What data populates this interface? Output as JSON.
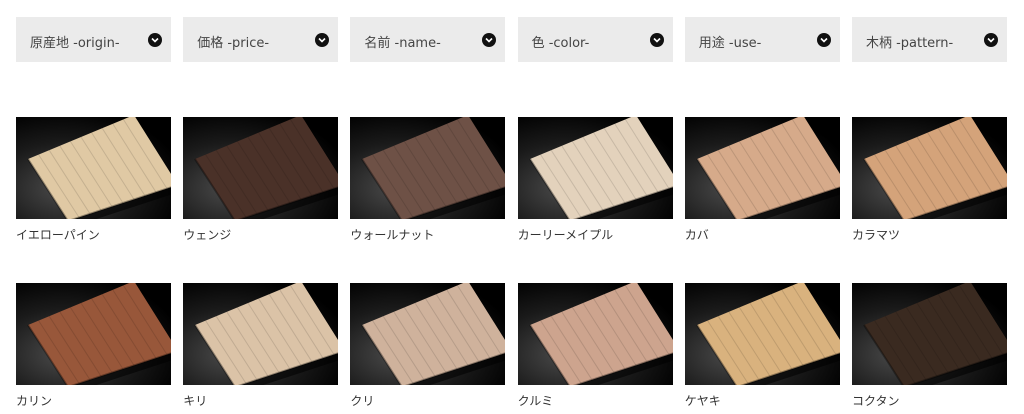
{
  "filters": [
    {
      "label": "原産地 -origin-",
      "icon": "chevron-down-icon"
    },
    {
      "label": "価格 -price-",
      "icon": "chevron-down-icon"
    },
    {
      "label": "名前 -name-",
      "icon": "chevron-down-icon"
    },
    {
      "label": "色 -color-",
      "icon": "chevron-down-icon"
    },
    {
      "label": "用途 -use-",
      "icon": "chevron-down-icon"
    },
    {
      "label": "木柄 -pattern-",
      "icon": "chevron-down-icon"
    }
  ],
  "woods": [
    {
      "name": "イエローパイン",
      "color": "#e0c9a4"
    },
    {
      "name": "ウェンジ",
      "color": "#4a3128"
    },
    {
      "name": "ウォールナット",
      "color": "#6e5146"
    },
    {
      "name": "カーリーメイプル",
      "color": "#e3d2bc"
    },
    {
      "name": "カバ",
      "color": "#d6aa8a"
    },
    {
      "name": "カラマツ",
      "color": "#d4a37a"
    },
    {
      "name": "カリン",
      "color": "#98573a"
    },
    {
      "name": "キリ",
      "color": "#dbc3a7"
    },
    {
      "name": "クリ",
      "color": "#cfb29c"
    },
    {
      "name": "クルミ",
      "color": "#cda48e"
    },
    {
      "name": "ケヤキ",
      "color": "#d9b27e"
    },
    {
      "name": "コクタン",
      "color": "#3a2a20"
    }
  ]
}
